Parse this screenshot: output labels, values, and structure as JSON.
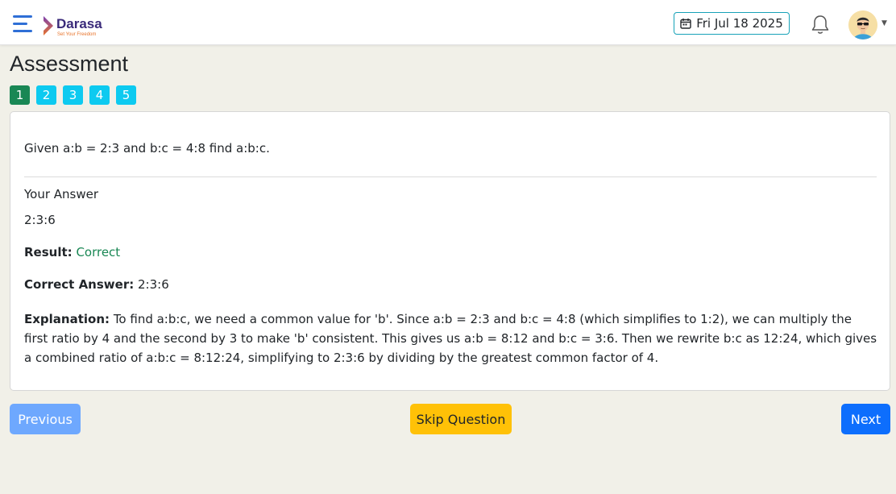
{
  "header": {
    "brand_name": "Darasa",
    "brand_tagline": "Set Your Freedom",
    "date": "Fri Jul 18 2025"
  },
  "page": {
    "title": "Assessment",
    "question_numbers": [
      "1",
      "2",
      "3",
      "4",
      "5"
    ],
    "active_question": 1
  },
  "question": {
    "text": "Given a:b = 2:3 and b:c = 4:8 find a:b:c.",
    "your_answer_label": "Your Answer",
    "your_answer": "2:3:6",
    "result_label": "Result:",
    "result_value": "Correct",
    "correct_answer_label": "Correct Answer:",
    "correct_answer": "2:3:6",
    "explanation_label": "Explanation:",
    "explanation": "To find a:b:c, we need a common value for 'b'. Since a:b = 2:3 and b:c = 4:8 (which simplifies to 1:2), we can multiply the first ratio by 4 and the second by 3 to make 'b' consistent. This gives us a:b = 8:12 and b:c = 3:6. Then we rewrite b:c as 12:24, which gives a combined ratio of a:b:c = 8:12:24, simplifying to 2:3:6 by dividing by the greatest common factor of 4."
  },
  "actions": {
    "previous": "Previous",
    "skip": "Skip Question",
    "next": "Next"
  },
  "colors": {
    "background": "#f1f0e8",
    "active_question": "#198754",
    "question_badge": "#0dcaf0",
    "correct_text": "#198754",
    "previous_button": "#6ea8fe",
    "skip_button": "#ffc107",
    "next_button": "#0d6efd"
  }
}
